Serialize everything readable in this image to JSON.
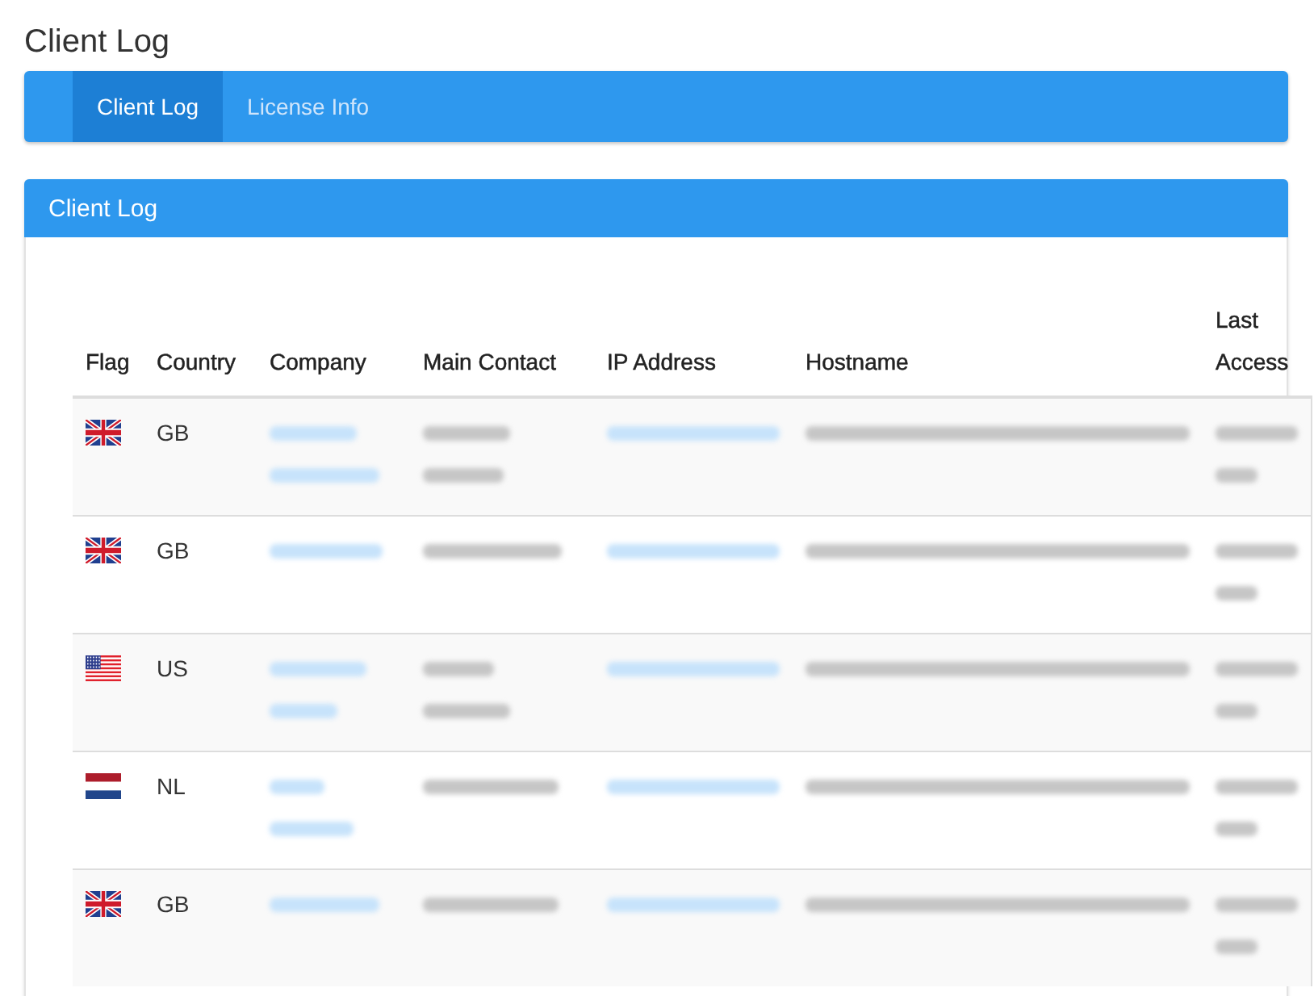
{
  "page": {
    "title": "Client Log"
  },
  "tabs": [
    {
      "label": "Client Log",
      "selected": true
    },
    {
      "label": "License Info",
      "selected": false
    }
  ],
  "panel": {
    "title": "Client Log",
    "table": {
      "columns": [
        "Flag",
        "Country",
        "Company",
        "Main Contact",
        "IP Address",
        "Hostname",
        "Last Access"
      ],
      "rows": [
        {
          "flag": {
            "kind": "uk"
          },
          "country": "GB",
          "company": [
            {
              "kind": "redacted-link"
            },
            {
              "kind": "redacted-link"
            }
          ],
          "main_contact": [
            {
              "kind": "redacted-text"
            },
            {
              "kind": "redacted-text"
            }
          ],
          "ip_address": [
            {
              "kind": "redacted-link"
            }
          ],
          "hostname": [
            {
              "kind": "redacted-text"
            }
          ],
          "last_access": [
            {
              "kind": "redacted-text"
            },
            {
              "kind": "redacted-text"
            }
          ]
        },
        {
          "flag": {
            "kind": "uk"
          },
          "country": "GB",
          "company": [
            {
              "kind": "redacted-link"
            }
          ],
          "main_contact": [
            {
              "kind": "redacted-text"
            }
          ],
          "ip_address": [
            {
              "kind": "redacted-link"
            }
          ],
          "hostname": [
            {
              "kind": "redacted-text"
            }
          ],
          "last_access": [
            {
              "kind": "redacted-text"
            },
            {
              "kind": "redacted-text"
            }
          ]
        },
        {
          "flag": {
            "kind": "us"
          },
          "country": "US",
          "company": [
            {
              "kind": "redacted-link"
            },
            {
              "kind": "redacted-link"
            }
          ],
          "main_contact": [
            {
              "kind": "redacted-text"
            },
            {
              "kind": "redacted-text"
            }
          ],
          "ip_address": [
            {
              "kind": "redacted-link"
            }
          ],
          "hostname": [
            {
              "kind": "redacted-text"
            }
          ],
          "last_access": [
            {
              "kind": "redacted-text"
            },
            {
              "kind": "redacted-text"
            }
          ]
        },
        {
          "flag": {
            "kind": "nl"
          },
          "country": "NL",
          "company": [
            {
              "kind": "redacted-link"
            },
            {
              "kind": "redacted-link"
            }
          ],
          "main_contact": [
            {
              "kind": "redacted-text"
            }
          ],
          "ip_address": [
            {
              "kind": "redacted-link"
            }
          ],
          "hostname": [
            {
              "kind": "redacted-text"
            }
          ],
          "last_access": [
            {
              "kind": "redacted-text"
            },
            {
              "kind": "redacted-text"
            }
          ]
        },
        {
          "flag": {
            "kind": "uk"
          },
          "country": "GB",
          "company": [
            {
              "kind": "redacted-link"
            }
          ],
          "main_contact": [
            {
              "kind": "redacted-text"
            }
          ],
          "ip_address": [
            {
              "kind": "redacted-link"
            }
          ],
          "hostname": [
            {
              "kind": "redacted-text"
            }
          ],
          "last_access": [
            {
              "kind": "redacted-text"
            },
            {
              "kind": "redacted-text"
            }
          ]
        }
      ]
    }
  }
}
